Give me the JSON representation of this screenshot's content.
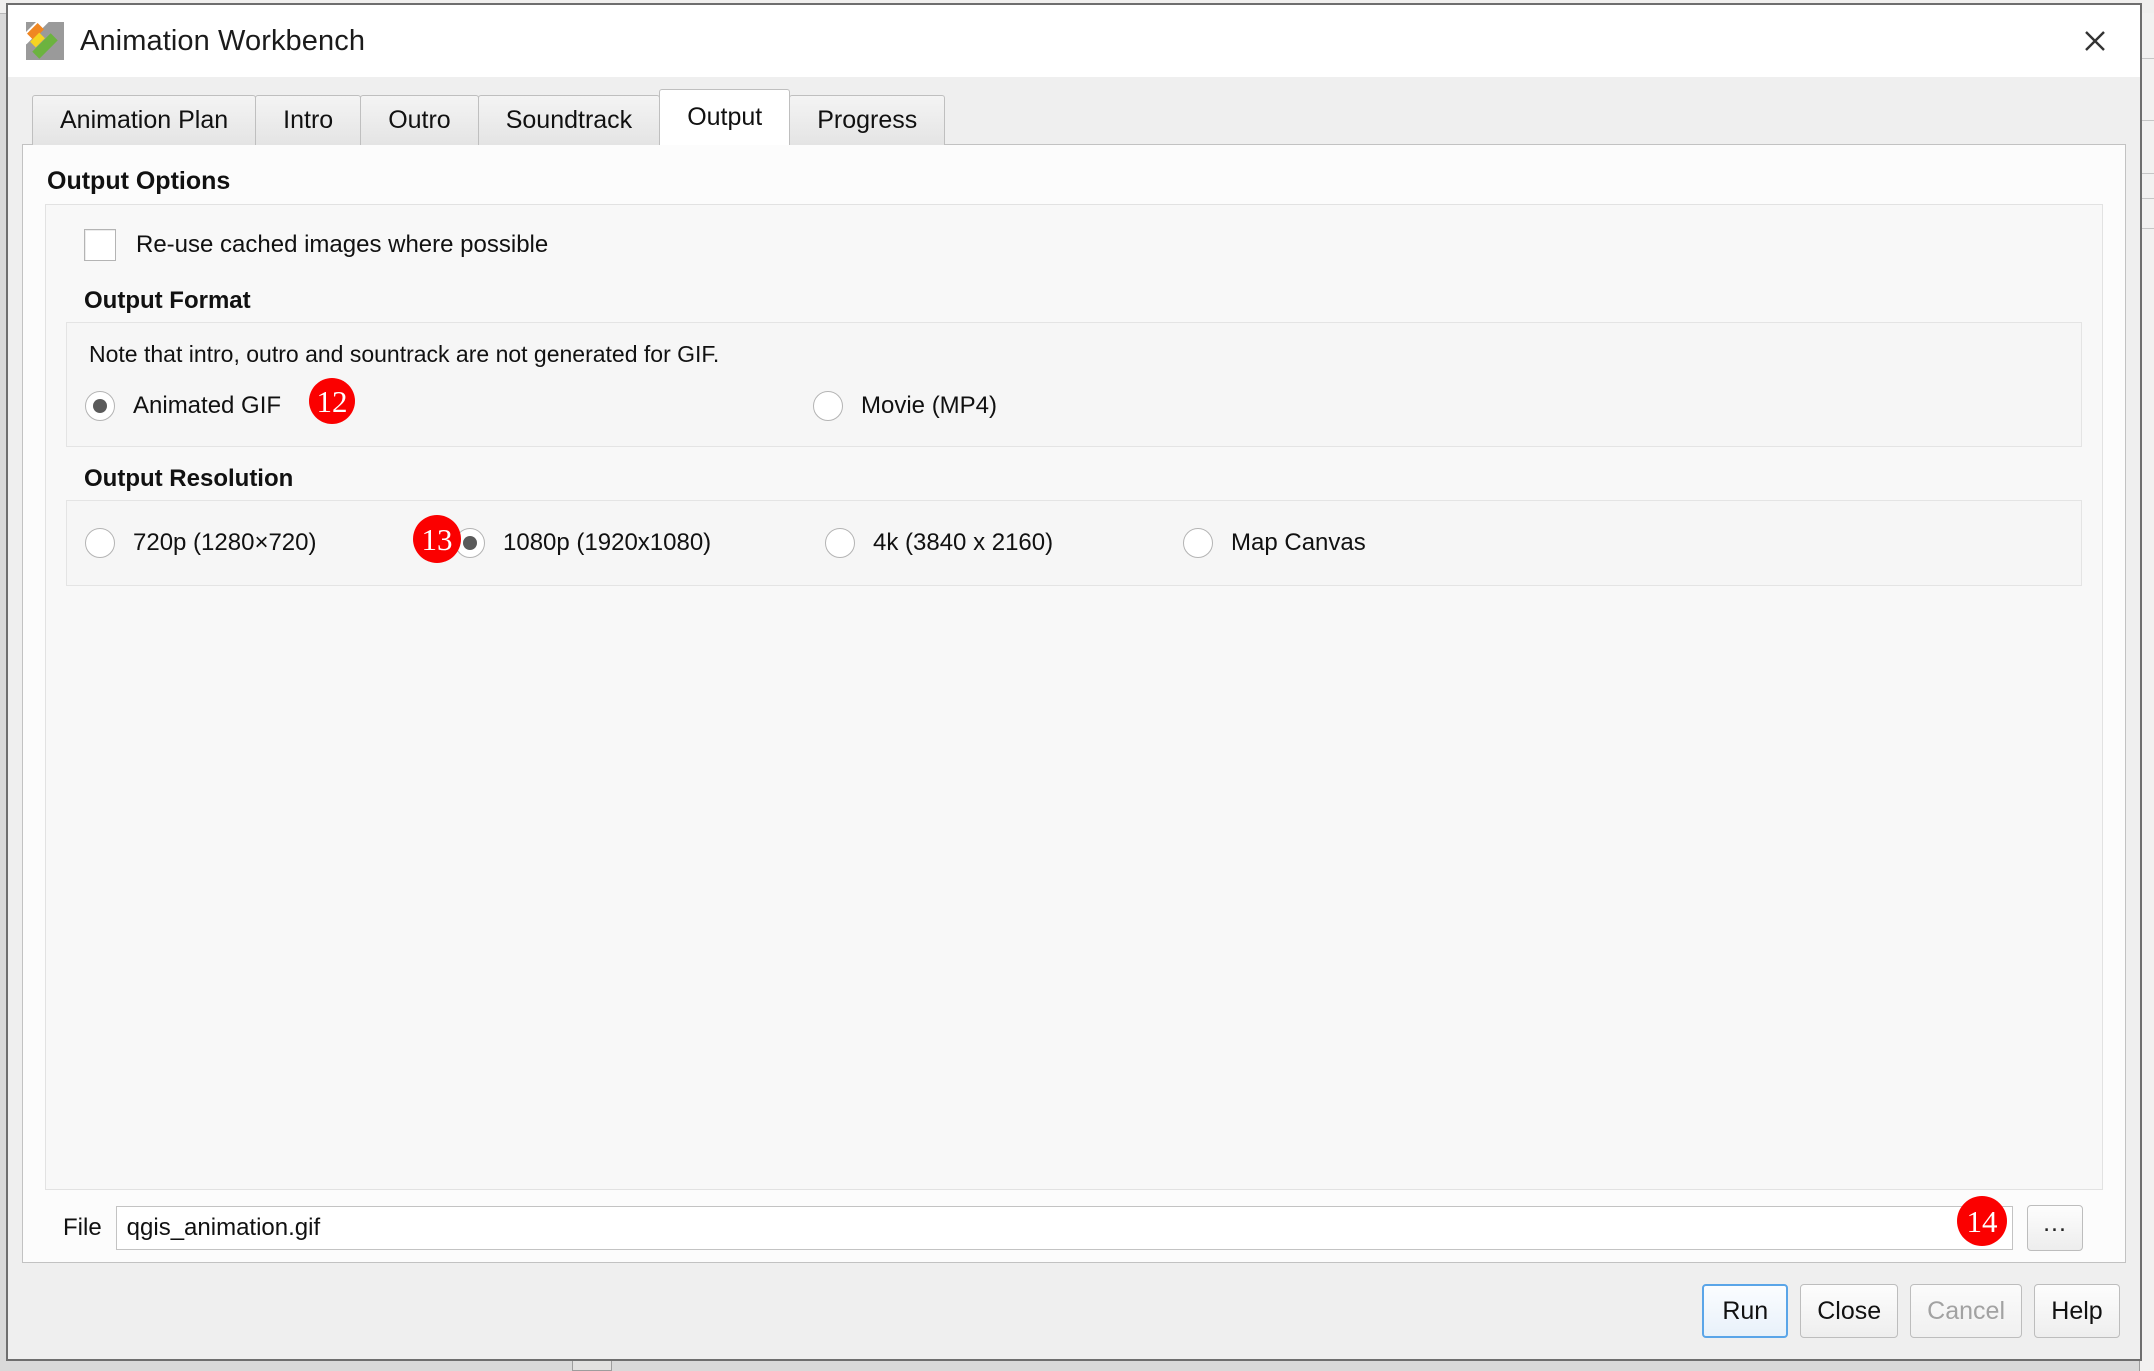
{
  "window": {
    "title": "Animation Workbench",
    "icon": "qgis-animation-workbench-icon",
    "close_label": "✕"
  },
  "tabs": [
    {
      "label": "Animation Plan",
      "active": false
    },
    {
      "label": "Intro",
      "active": false
    },
    {
      "label": "Outro",
      "active": false
    },
    {
      "label": "Soundtrack",
      "active": false
    },
    {
      "label": "Output",
      "active": true
    },
    {
      "label": "Progress",
      "active": false
    }
  ],
  "output_options": {
    "title": "Output Options",
    "reuse_cache": {
      "label": "Re-use cached images where possible",
      "checked": false
    },
    "output_format": {
      "title": "Output Format",
      "note": "Note that intro, outro and sountrack are not generated for GIF.",
      "options": [
        {
          "label": "Animated GIF",
          "selected": true,
          "badge": "12"
        },
        {
          "label": "Movie (MP4)",
          "selected": false,
          "badge": ""
        }
      ]
    },
    "output_resolution": {
      "title": "Output Resolution",
      "options": [
        {
          "label": "720p (1280×720)",
          "selected": false,
          "badge": ""
        },
        {
          "label": "1080p (1920x1080)",
          "selected": true,
          "badge": "13"
        },
        {
          "label": "4k (3840 x 2160)",
          "selected": false,
          "badge": ""
        },
        {
          "label": "Map Canvas",
          "selected": false,
          "badge": ""
        }
      ]
    }
  },
  "file_row": {
    "label": "File",
    "value": "qgis_animation.gif",
    "placeholder": "",
    "browse_label": "...",
    "badge": "14"
  },
  "buttons": [
    {
      "label": "Run",
      "state": "default"
    },
    {
      "label": "Close",
      "state": "normal"
    },
    {
      "label": "Cancel",
      "state": "disabled"
    },
    {
      "label": "Help",
      "state": "normal"
    }
  ],
  "colors": {
    "badge_red": "#fb0000",
    "badge_text": "#ffffff",
    "focus_blue": "#5aa5e8",
    "dialog_bg": "#efefef",
    "panel_bg": "#fcfcfc"
  }
}
